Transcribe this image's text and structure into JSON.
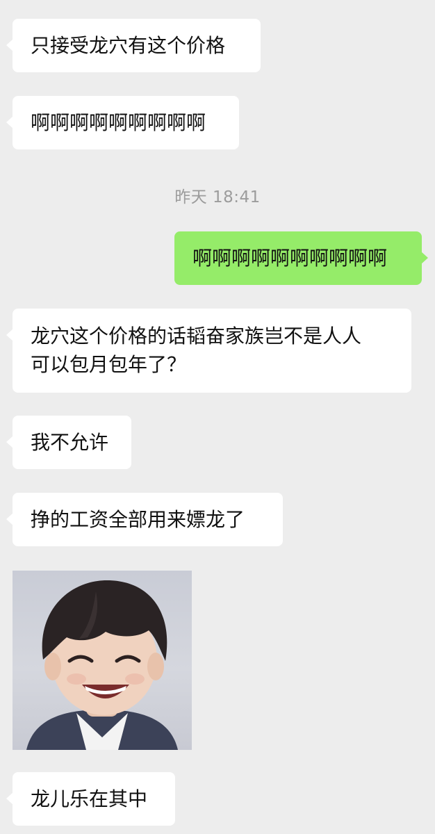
{
  "messages": [
    {
      "side": "left",
      "text": "只接受龙穴有这个价格"
    },
    {
      "side": "left",
      "text": "啊啊啊啊啊啊啊啊啊"
    },
    {
      "side": "right",
      "text": "啊啊啊啊啊啊啊啊啊啊"
    },
    {
      "side": "left",
      "text": "龙穴这个价格的话韬奋家族岂不是人人\n可以包月包年了？"
    },
    {
      "side": "left",
      "text": "我不允许"
    },
    {
      "side": "left",
      "text": "挣的工资全部用来嫖龙了"
    },
    {
      "side": "left",
      "text": "龙儿乐在其中"
    }
  ],
  "timestamp": "昨天 18:41",
  "sticker": {
    "description_icon": "smiling-person-sticker-icon"
  },
  "colors": {
    "background": "#ededed",
    "incoming_bubble": "#ffffff",
    "outgoing_bubble": "#95ec69",
    "timestamp_text": "#9c9c9c"
  }
}
